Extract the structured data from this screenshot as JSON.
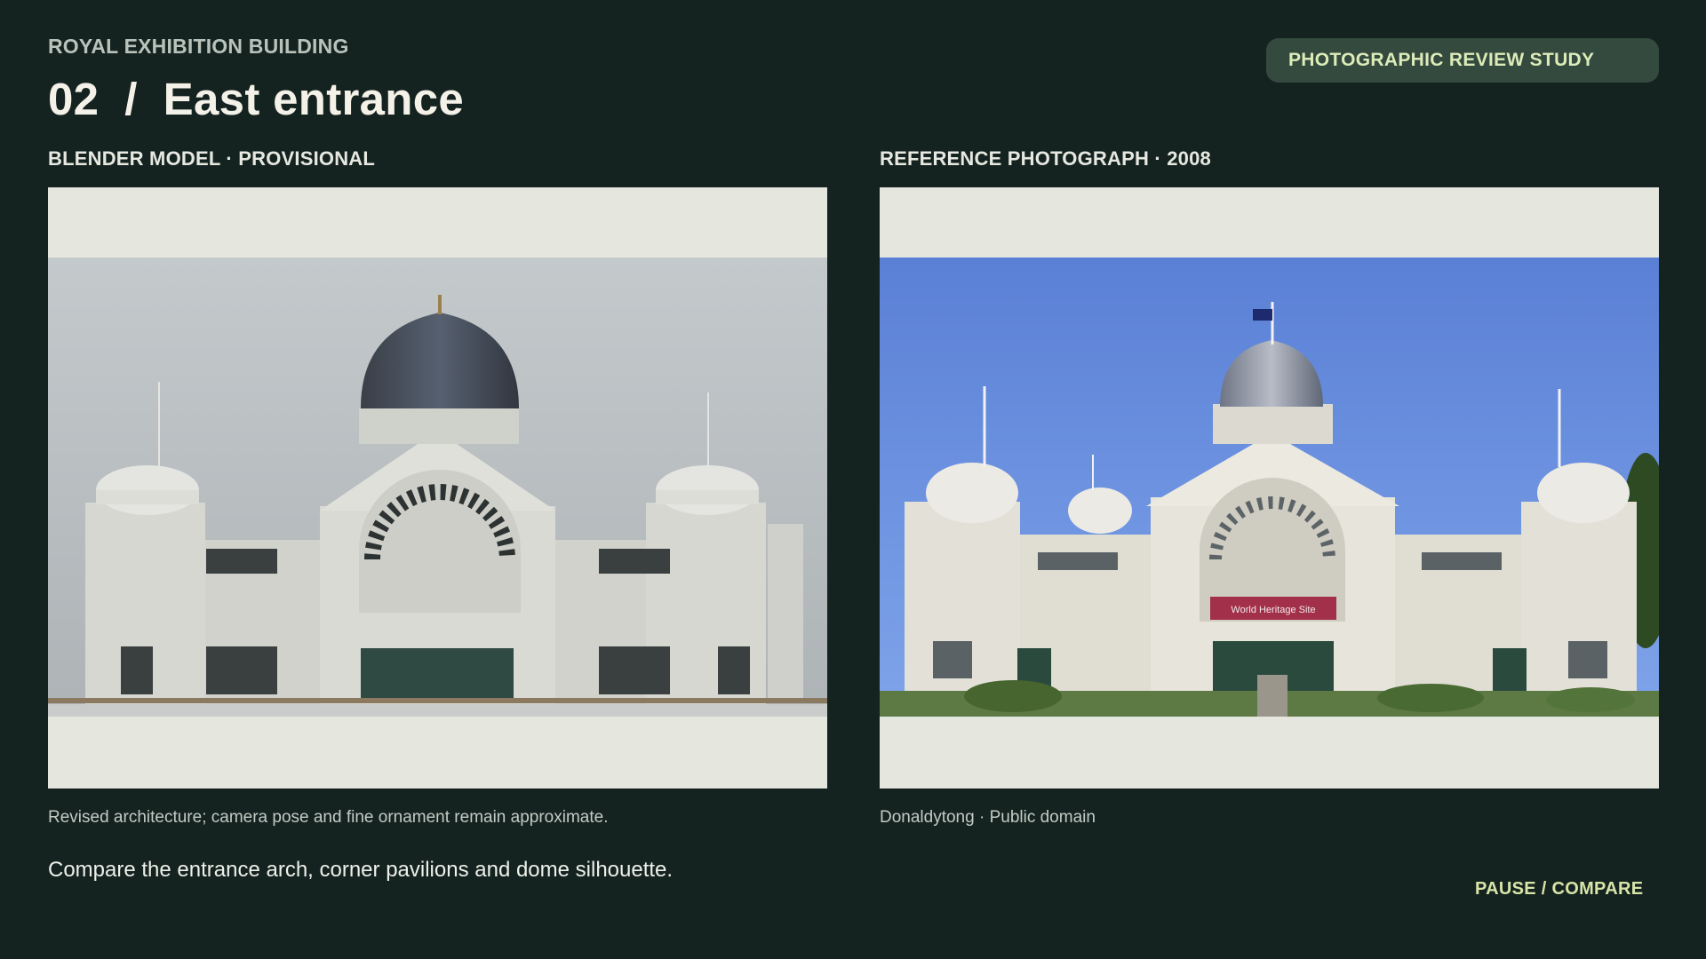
{
  "header": {
    "eyebrow": "ROYAL EXHIBITION BUILDING",
    "title": "02  /  East entrance",
    "badge": "PHOTOGRAPHIC REVIEW STUDY"
  },
  "panels": {
    "model": {
      "label": "BLENDER MODEL · PROVISIONAL",
      "caption": "Revised architecture; camera pose and fine ornament remain approximate."
    },
    "photo": {
      "label": "REFERENCE PHOTOGRAPH · 2008",
      "caption": "Donaldytong · Public domain",
      "banner_text": "World Heritage Site"
    }
  },
  "footer": {
    "prompt": "Compare the entrance arch, corner pavilions and dome silhouette.",
    "action": "PAUSE / COMPARE"
  },
  "colors": {
    "background": "#152320",
    "chip": "#344a3e",
    "accent": "#d8e4a8",
    "frame": "#e5e6de"
  }
}
